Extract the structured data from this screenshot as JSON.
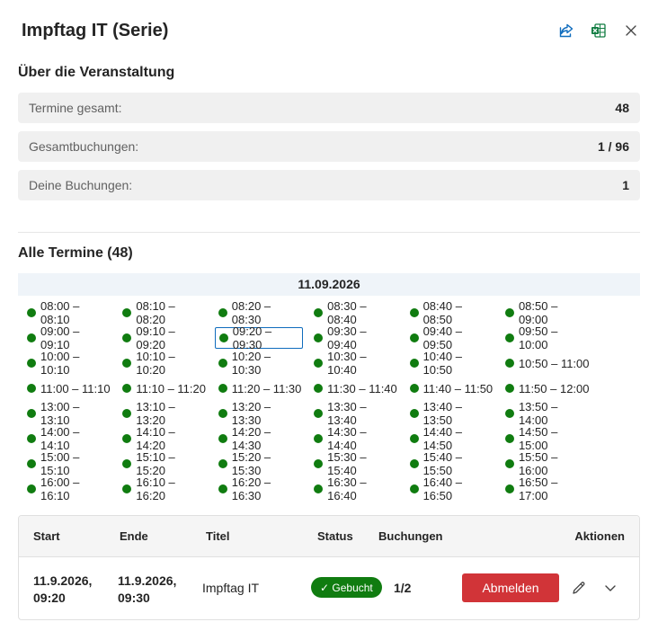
{
  "header": {
    "title": "Impftag IT (Serie)",
    "icons": [
      "share-icon",
      "excel-icon",
      "close-icon"
    ]
  },
  "about": {
    "title": "Über die Veranstaltung",
    "stats": [
      {
        "label": "Termine gesamt:",
        "value": "48"
      },
      {
        "label": "Gesamtbuchungen:",
        "value": "1 / 96"
      },
      {
        "label": "Deine Buchungen:",
        "value": "1"
      }
    ]
  },
  "appointments": {
    "title": "Alle Termine (48)",
    "date": "11.09.2026",
    "status_color": "#107c10",
    "selected_index": 8,
    "slots": [
      "08:00 – 08:10",
      "08:10 – 08:20",
      "08:20 – 08:30",
      "08:30 – 08:40",
      "08:40 – 08:50",
      "08:50 – 09:00",
      "09:00 – 09:10",
      "09:10 – 09:20",
      "09:20 – 09:30",
      "09:30 – 09:40",
      "09:40 – 09:50",
      "09:50 – 10:00",
      "10:00 – 10:10",
      "10:10 – 10:20",
      "10:20 – 10:30",
      "10:30 – 10:40",
      "10:40 – 10:50",
      "10:50 – 11:00",
      "11:00 – 11:10",
      "11:10 – 11:20",
      "11:20 – 11:30",
      "11:30 – 11:40",
      "11:40 – 11:50",
      "11:50 – 12:00",
      "13:00 – 13:10",
      "13:10 – 13:20",
      "13:20 – 13:30",
      "13:30 – 13:40",
      "13:40 – 13:50",
      "13:50 – 14:00",
      "14:00 – 14:10",
      "14:10 – 14:20",
      "14:20 – 14:30",
      "14:30 – 14:40",
      "14:40 – 14:50",
      "14:50 – 15:00",
      "15:00 – 15:10",
      "15:10 – 15:20",
      "15:20 – 15:30",
      "15:30 – 15:40",
      "15:40 – 15:50",
      "15:50 – 16:00",
      "16:00 – 16:10",
      "16:10 – 16:20",
      "16:20 – 16:30",
      "16:30 – 16:40",
      "16:40 – 16:50",
      "16:50 – 17:00"
    ]
  },
  "table": {
    "columns": {
      "start": "Start",
      "end": "Ende",
      "title": "Titel",
      "status": "Status",
      "bookings": "Buchungen",
      "actions": "Aktionen"
    },
    "row": {
      "start_date": "11.9.2026,",
      "start_time": "09:20",
      "end_date": "11.9.2026,",
      "end_time": "09:30",
      "title": "Impftag IT",
      "status": "✓ Gebucht",
      "bookings": "1/2",
      "cancel_label": "Abmelden"
    },
    "danger_color": "#d13438"
  }
}
